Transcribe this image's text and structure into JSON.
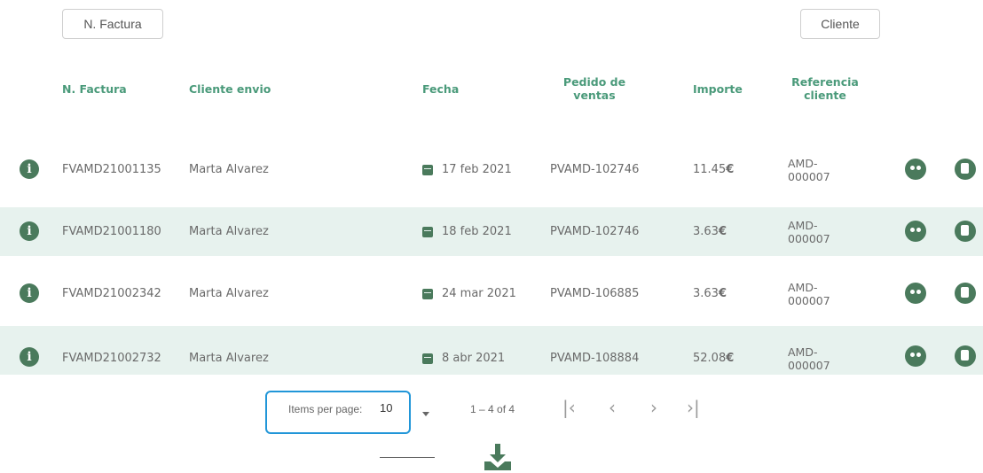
{
  "filters": {
    "invoice_btn": "N. Factura",
    "client_btn": "Cliente"
  },
  "headers": {
    "invoice": "N. Factura",
    "client": "Cliente envio",
    "date": "Fecha",
    "order_line1": "Pedido de",
    "order_line2": "ventas",
    "amount": "Importe",
    "ref_line1": "Referencia",
    "ref_line2": "cliente"
  },
  "rows": [
    {
      "invoice": "FVAMD21001135",
      "client": "Marta Alvarez",
      "date": "17 feb 2021",
      "order": "PVAMD-102746",
      "amount": "11.45",
      "currency": "€",
      "ref1": "AMD-",
      "ref2": "000007"
    },
    {
      "invoice": "FVAMD21001180",
      "client": "Marta Alvarez",
      "date": "18 feb 2021",
      "order": "PVAMD-102746",
      "amount": "3.63",
      "currency": "€",
      "ref1": "AMD-",
      "ref2": "000007"
    },
    {
      "invoice": "FVAMD21002342",
      "client": "Marta Alvarez",
      "date": "24 mar 2021",
      "order": "PVAMD-106885",
      "amount": "3.63",
      "currency": "€",
      "ref1": "AMD-",
      "ref2": "000007"
    },
    {
      "invoice": "FVAMD21002732",
      "client": "Marta Alvarez",
      "date": "8 abr 2021",
      "order": "PVAMD-108884",
      "amount": "52.08",
      "currency": "€",
      "ref1": "AMD-",
      "ref2": "000007"
    }
  ],
  "pagination": {
    "items_per_page_label": "Items per page:",
    "items_per_page_value": "10",
    "range": "1 – 4 of 4"
  },
  "icons": {
    "info": "info-icon",
    "calendar": "calendar-icon",
    "face": "customer-icon",
    "pdf": "pdf-icon",
    "download": "download-icon"
  },
  "colors": {
    "accent": "#4a7a5c",
    "header_text": "#4a9a7a",
    "row_alt": "#e7f2ee",
    "focus": "#2196d8"
  }
}
